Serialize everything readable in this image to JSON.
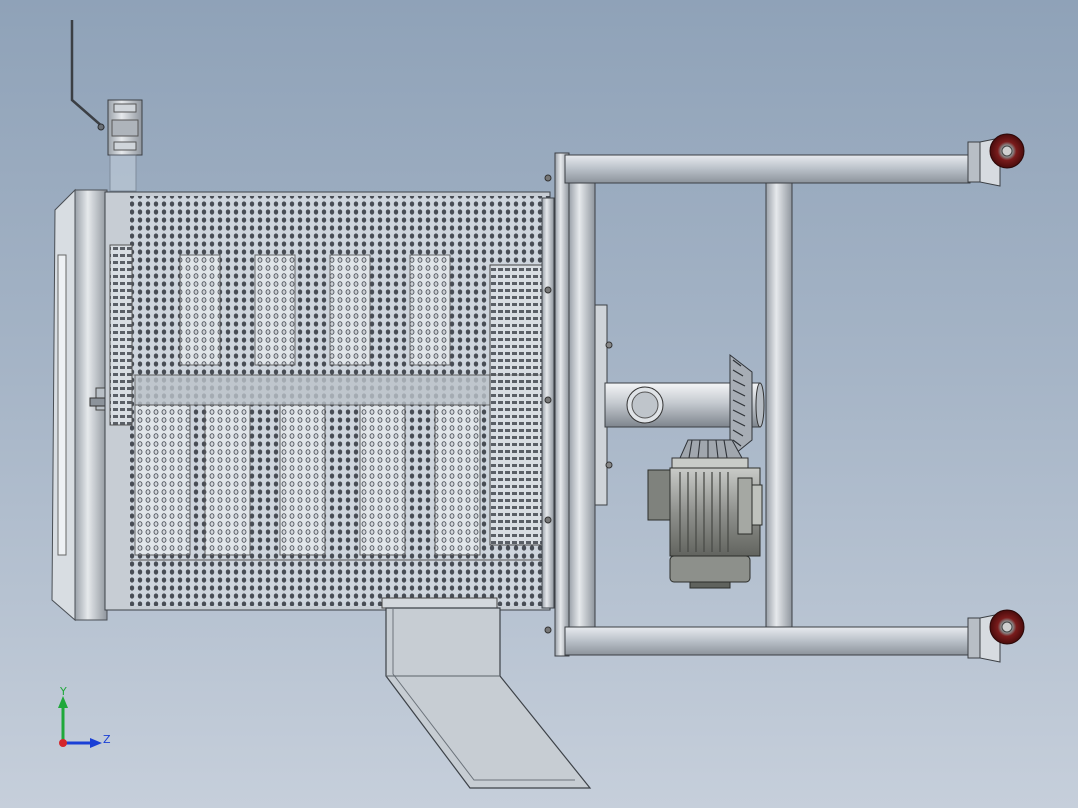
{
  "viewport": {
    "background_top": "#8fa2b8",
    "background_bottom": "#c6cfdb"
  },
  "model": {
    "components": [
      "drain-valve",
      "perforated-drum",
      "end-cap",
      "discharge-chute",
      "support-frame",
      "caster-wheel",
      "drive-shaft",
      "bevel-gear",
      "gear-motor"
    ]
  },
  "triad": {
    "y_label": "Y",
    "z_label": "Z",
    "y_color": "#1fa83a",
    "z_color": "#1a3fd6",
    "origin_color": "#d4262b"
  }
}
